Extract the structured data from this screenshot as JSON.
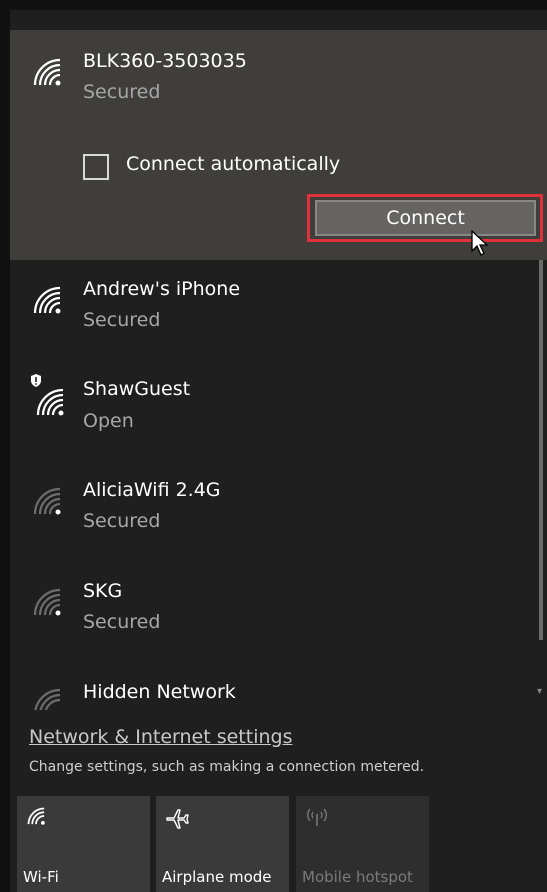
{
  "selected_network": {
    "name": "BLK360-3503035",
    "status": "Secured",
    "connect_auto_label": "Connect automatically",
    "connect_auto_checked": false,
    "connect_button": "Connect",
    "wifi_icon": "wifi-secured-icon"
  },
  "networks": [
    {
      "name": "Andrew's iPhone",
      "status": "Secured",
      "icon": "wifi-strong-icon"
    },
    {
      "name": "ShawGuest",
      "status": "Open",
      "icon": "wifi-open-shield-icon"
    },
    {
      "name": "AliciaWifi 2.4G",
      "status": "Secured",
      "icon": "wifi-weak-icon"
    },
    {
      "name": "SKG",
      "status": "Secured",
      "icon": "wifi-weak-icon"
    },
    {
      "name": "Hidden Network",
      "status": "",
      "icon": "wifi-weak-icon"
    }
  ],
  "settings": {
    "link": "Network & Internet settings",
    "description": "Change settings, such as making a connection metered."
  },
  "quick_actions": [
    {
      "label": "Wi-Fi",
      "icon": "wifi-icon",
      "enabled": true
    },
    {
      "label": "Airplane mode",
      "icon": "airplane-icon",
      "enabled": true
    },
    {
      "label": "Mobile hotspot",
      "icon": "mobile-hotspot-icon",
      "enabled": false
    }
  ],
  "colors": {
    "panel_bg": "#1f1f1f",
    "selected_bg": "#3f3e3b",
    "highlight": "#e0303a",
    "tile_bg": "#3a3a3a"
  }
}
